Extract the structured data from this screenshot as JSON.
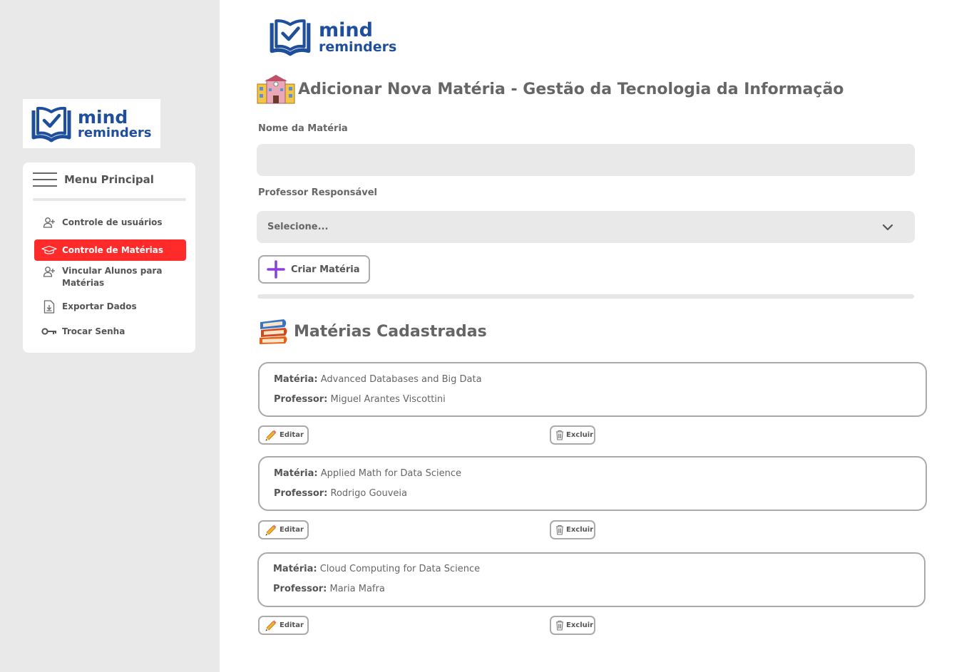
{
  "app": {
    "brand_line1": "mind",
    "brand_line2": "reminders"
  },
  "sidebar": {
    "menu_title": "Menu Principal",
    "items": [
      {
        "label": "Controle de usuários",
        "icon": "user-plus-icon",
        "active": false
      },
      {
        "label": "Controle de Matérias",
        "icon": "graduation-cap-icon",
        "active": true
      },
      {
        "label": "Vincular Alunos para Matérias",
        "icon": "user-plus-icon",
        "active": false
      },
      {
        "label": "Exportar Dados",
        "icon": "file-download-icon",
        "active": false
      },
      {
        "label": "Trocar Senha",
        "icon": "key-icon",
        "active": false
      }
    ]
  },
  "main": {
    "page_title": "Adicionar Nova Matéria - Gestão da Tecnologia da Informação",
    "title_icon": "school-icon",
    "form": {
      "name_label": "Nome da Matéria",
      "name_value": "",
      "professor_label": "Professor Responsável",
      "professor_selected": "Selecione...",
      "create_button": "Criar Matéria"
    },
    "list_title": "Matérias Cadastradas",
    "list_icon": "books-icon",
    "subject_key": "Matéria:",
    "professor_key": "Professor:",
    "edit_label": "Editar",
    "delete_label": "Excluir",
    "subjects": [
      {
        "name": "Advanced Databases and Big Data",
        "professor": "Miguel Arantes Viscottini"
      },
      {
        "name": "Applied Math for Data Science",
        "professor": "Rodrigo Gouveia"
      },
      {
        "name": "Cloud Computing for Data Science",
        "professor": "Maria Mafra"
      }
    ]
  },
  "colors": {
    "accent": "#ff2b2b",
    "brand": "#1f4f9c",
    "sidebar_bg": "#e9e9e9",
    "border": "#aaaaaa",
    "plus": "#8b3fe0"
  }
}
